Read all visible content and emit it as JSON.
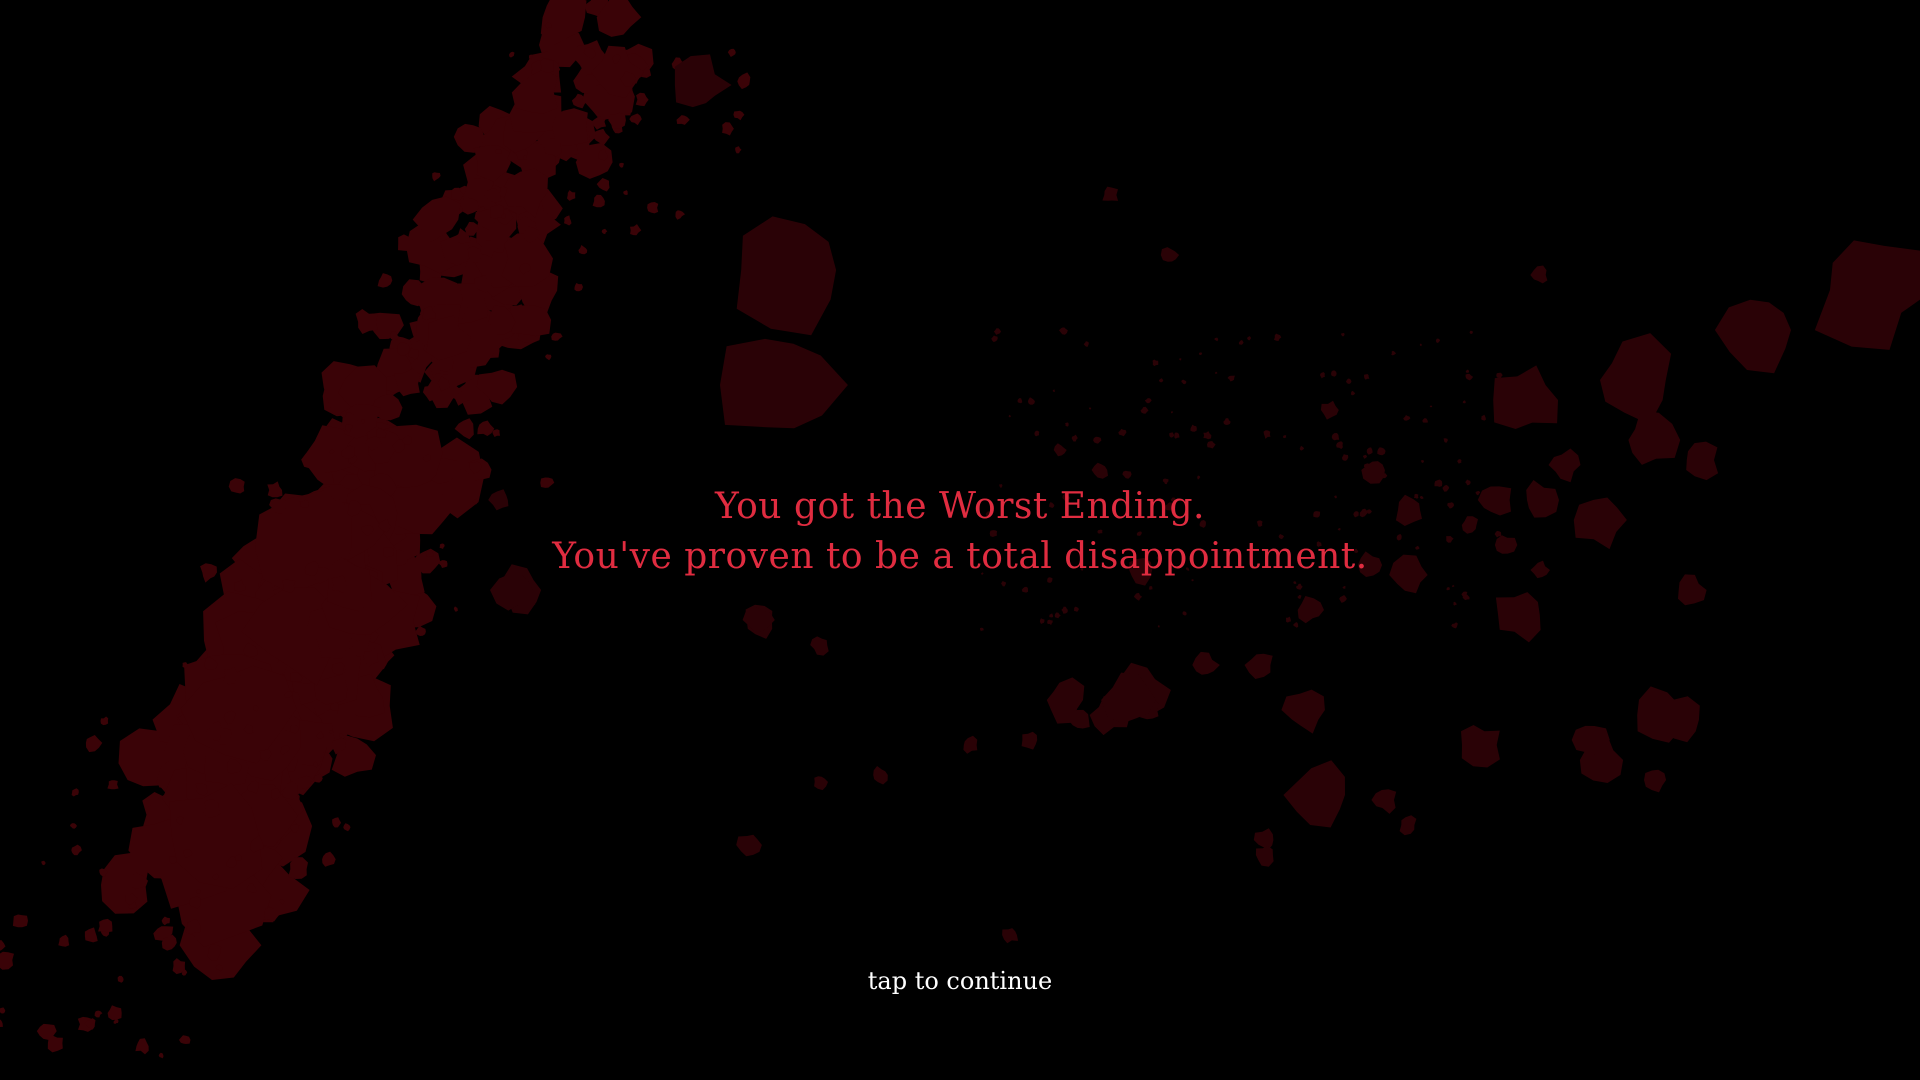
{
  "ending": {
    "line1": "You got the Worst Ending.",
    "line2": "You've proven to be a total disappointment."
  },
  "prompt": {
    "continue_label": "tap to continue"
  },
  "colors": {
    "background": "#000000",
    "blood": "#3a0307",
    "blood_dark": "#2a0206",
    "ending_text": "#e02c40",
    "prompt_text": "#ffffff"
  }
}
